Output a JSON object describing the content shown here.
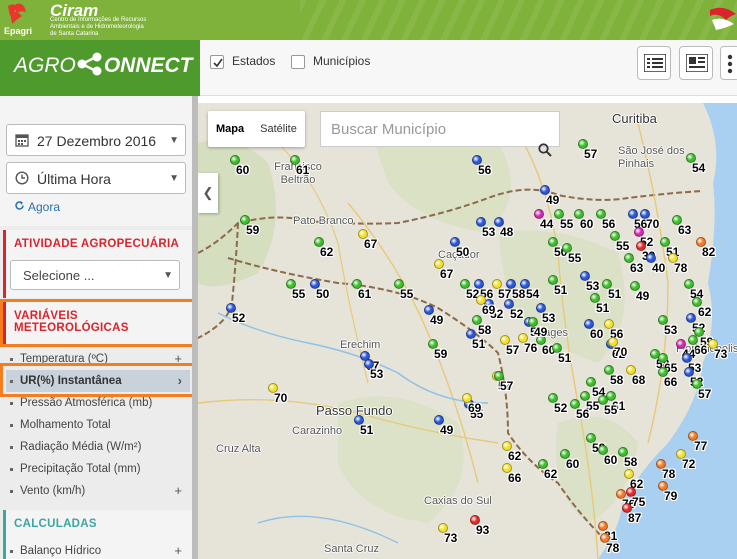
{
  "header": {
    "epagri_label": "Epagri",
    "ciram_title": "Ciram",
    "ciram_subtitle": "Centro de Informações de Recursos Ambientais e de Hidrometeorologia de Santa Catarina",
    "brand_left": "AGRO",
    "brand_right": "ONNECT"
  },
  "toolbar": {
    "estados_label": "Estados",
    "estados_checked": true,
    "municipios_label": "Municípios",
    "municipios_checked": false
  },
  "sidebar": {
    "date_value": "27 Dezembro 2016",
    "time_value": "Última Hora",
    "agora_label": "Agora",
    "atividade_title": "ATIVIDADE AGROPECUÁRIA",
    "atividade_select": "Selecione ...",
    "variaveis_title_1": "VARIÁVEIS",
    "variaveis_title_2": "METEOROLÓGICAS",
    "variables": [
      {
        "label": "Temperatura (ºC)",
        "expand": "+"
      },
      {
        "label": "UR(%) Instantânea",
        "expand": "›"
      },
      {
        "label": "Pressão Atmosférica (mb)",
        "expand": ""
      },
      {
        "label": "Molhamento Total",
        "expand": ""
      },
      {
        "label": "Radiação Média (W/m²)",
        "expand": ""
      },
      {
        "label": "Precipitação Total (mm)",
        "expand": ""
      },
      {
        "label": "Vento (km/h)",
        "expand": "+"
      }
    ],
    "calculadas_title": "CALCULADAS",
    "calculadas_items": [
      {
        "label": "Balanço Hídrico",
        "expand": "+"
      }
    ]
  },
  "map": {
    "type_map": "Mapa",
    "type_satellite": "Satélite",
    "search_placeholder": "Buscar Município",
    "cities": [
      {
        "name": "Curitiba",
        "big": true
      },
      {
        "name": "São José dos Pinhais",
        "big": false
      },
      {
        "name": "Francisco Beltrão",
        "big": false
      },
      {
        "name": "Pato Branco",
        "big": false
      },
      {
        "name": "Caçador",
        "big": false
      },
      {
        "name": "Erechim",
        "big": false
      },
      {
        "name": "Passo Fundo",
        "big": true
      },
      {
        "name": "Carazinho",
        "big": false
      },
      {
        "name": "Cruz Alta",
        "big": false
      },
      {
        "name": "Caxias do Sul",
        "big": false
      },
      {
        "name": "Lages",
        "big": false
      },
      {
        "name": "Santa Cruz",
        "big": false
      },
      {
        "name": "Florianópolis",
        "big": false
      }
    ],
    "colors": {
      "green": "#3dbd2a",
      "blue": "#2b55d6",
      "yellow": "#f2e02a",
      "orange": "#f07a26",
      "red": "#e02a2a",
      "magenta": "#d02ab0"
    },
    "stations": [
      {
        "v": "60",
        "c": "green"
      },
      {
        "v": "61",
        "c": "green"
      },
      {
        "v": "56",
        "c": "blue"
      },
      {
        "v": "57",
        "c": "green"
      },
      {
        "v": "54",
        "c": "green"
      },
      {
        "v": "49",
        "c": "blue"
      },
      {
        "v": "59",
        "c": "green"
      },
      {
        "v": "62",
        "c": "green"
      },
      {
        "v": "67",
        "c": "yellow"
      },
      {
        "v": "50",
        "c": "blue"
      },
      {
        "v": "53",
        "c": "blue"
      },
      {
        "v": "48",
        "c": "blue"
      },
      {
        "v": "44",
        "c": "magenta"
      },
      {
        "v": "55",
        "c": "green"
      },
      {
        "v": "60",
        "c": "green"
      },
      {
        "v": "56",
        "c": "green"
      },
      {
        "v": "55",
        "c": "green"
      },
      {
        "v": "56",
        "c": "blue"
      },
      {
        "v": "70",
        "c": "blue"
      },
      {
        "v": "63",
        "c": "green"
      },
      {
        "v": "52",
        "c": "magenta"
      },
      {
        "v": "82",
        "c": "orange"
      },
      {
        "v": "63",
        "c": "green"
      },
      {
        "v": "50",
        "c": "green"
      },
      {
        "v": "55",
        "c": "green"
      },
      {
        "v": "39",
        "c": "red"
      },
      {
        "v": "51",
        "c": "green"
      },
      {
        "v": "40",
        "c": "blue"
      },
      {
        "v": "78",
        "c": "yellow"
      },
      {
        "v": "55",
        "c": "green"
      },
      {
        "v": "50",
        "c": "blue"
      },
      {
        "v": "61",
        "c": "green"
      },
      {
        "v": "55",
        "c": "green"
      },
      {
        "v": "67",
        "c": "yellow"
      },
      {
        "v": "56",
        "c": "blue"
      },
      {
        "v": "57",
        "c": "yellow"
      },
      {
        "v": "58",
        "c": "blue"
      },
      {
        "v": "54",
        "c": "blue"
      },
      {
        "v": "51",
        "c": "green"
      },
      {
        "v": "53",
        "c": "blue"
      },
      {
        "v": "53",
        "c": "blue"
      },
      {
        "v": "49",
        "c": "blue"
      },
      {
        "v": "52",
        "c": "green"
      },
      {
        "v": "52",
        "c": "blue"
      },
      {
        "v": "52",
        "c": "blue"
      },
      {
        "v": "51",
        "c": "blue"
      },
      {
        "v": "58",
        "c": "green"
      },
      {
        "v": "69",
        "c": "yellow"
      },
      {
        "v": "51",
        "c": "blue"
      },
      {
        "v": "60",
        "c": "green"
      },
      {
        "v": "51",
        "c": "green"
      },
      {
        "v": "51",
        "c": "green"
      },
      {
        "v": "49",
        "c": "green"
      },
      {
        "v": "54",
        "c": "green"
      },
      {
        "v": "62",
        "c": "green"
      },
      {
        "v": "52",
        "c": "blue"
      },
      {
        "v": "57",
        "c": "yellow"
      },
      {
        "v": "49",
        "c": "green"
      },
      {
        "v": "60",
        "c": "blue"
      },
      {
        "v": "56",
        "c": "yellow"
      },
      {
        "v": "53",
        "c": "green"
      },
      {
        "v": "59",
        "c": "green"
      },
      {
        "v": "62",
        "c": "blue"
      },
      {
        "v": "59",
        "c": "green"
      },
      {
        "v": "52",
        "c": "blue"
      },
      {
        "v": "76",
        "c": "yellow"
      },
      {
        "v": "67",
        "c": "blue"
      },
      {
        "v": "70",
        "c": "yellow"
      },
      {
        "v": "66",
        "c": "green"
      },
      {
        "v": "58",
        "c": "green"
      },
      {
        "v": "65",
        "c": "green"
      },
      {
        "v": "44",
        "c": "magenta"
      },
      {
        "v": "73",
        "c": "yellow"
      },
      {
        "v": "53",
        "c": "blue"
      },
      {
        "v": "51",
        "c": "green"
      },
      {
        "v": "68",
        "c": "yellow"
      },
      {
        "v": "66",
        "c": "green"
      },
      {
        "v": "52",
        "c": "blue"
      },
      {
        "v": "58",
        "c": "green"
      },
      {
        "v": "54",
        "c": "green"
      },
      {
        "v": "57",
        "c": "green"
      },
      {
        "v": "61",
        "c": "green"
      },
      {
        "v": "55",
        "c": "green"
      },
      {
        "v": "57",
        "c": "yellow"
      },
      {
        "v": "52",
        "c": "green"
      },
      {
        "v": "55",
        "c": "green"
      },
      {
        "v": "56",
        "c": "green"
      },
      {
        "v": "55",
        "c": "blue"
      },
      {
        "v": "70",
        "c": "yellow"
      },
      {
        "v": "69",
        "c": "yellow"
      },
      {
        "v": "57",
        "c": "green"
      },
      {
        "v": "53",
        "c": "blue"
      },
      {
        "v": "51",
        "c": "blue"
      },
      {
        "v": "49",
        "c": "blue"
      },
      {
        "v": "77",
        "c": "orange"
      },
      {
        "v": "62",
        "c": "yellow"
      },
      {
        "v": "60",
        "c": "green"
      },
      {
        "v": "58",
        "c": "green"
      },
      {
        "v": "60",
        "c": "green"
      },
      {
        "v": "58",
        "c": "green"
      },
      {
        "v": "66",
        "c": "yellow"
      },
      {
        "v": "62",
        "c": "green"
      },
      {
        "v": "78",
        "c": "orange"
      },
      {
        "v": "72",
        "c": "yellow"
      },
      {
        "v": "62",
        "c": "yellow"
      },
      {
        "v": "76",
        "c": "orange"
      },
      {
        "v": "75",
        "c": "red"
      },
      {
        "v": "79",
        "c": "orange"
      },
      {
        "v": "87",
        "c": "red"
      },
      {
        "v": "81",
        "c": "orange"
      },
      {
        "v": "73",
        "c": "yellow"
      },
      {
        "v": "93",
        "c": "red"
      },
      {
        "v": "78",
        "c": "orange"
      }
    ]
  }
}
